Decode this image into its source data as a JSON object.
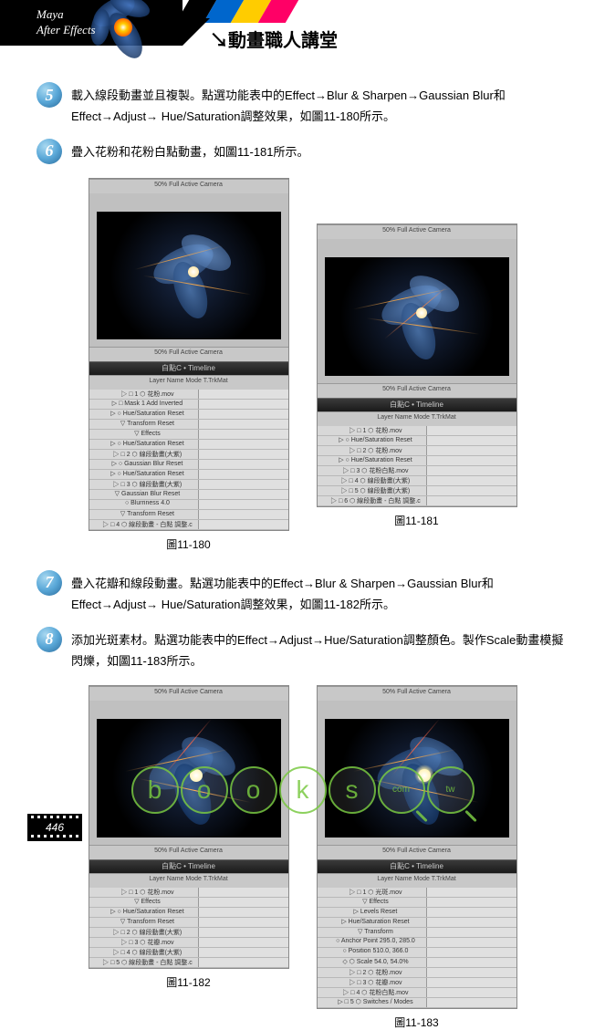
{
  "header": {
    "product1": "Maya",
    "product2": "After Effects",
    "title": "動畫職人講堂",
    "arrow": "↘"
  },
  "steps": [
    {
      "num": "5",
      "text": "載入線段動畫並且複製。點選功能表中的Effect→Blur & Sharpen→Gaussian Blur和Effect→Adjust→ Hue/Saturation調整效果，如圖11-180所示。"
    },
    {
      "num": "6",
      "text": "疊入花粉和花粉白點動畫，如圖11-181所示。"
    },
    {
      "num": "7",
      "text": "疊入花瓣和線段動畫。點選功能表中的Effect→Blur & Sharpen→Gaussian Blur和Effect→Adjust→ Hue/Saturation調整效果，如圖11-182所示。"
    },
    {
      "num": "8",
      "text": "添加光斑素材。點選功能表中的Effect→Adjust→Hue/Saturation調整顏色。製作Scale動畫模擬閃爍，如圖11-183所示。"
    }
  ],
  "figures": {
    "f180": {
      "caption": "圖11-180",
      "timeline_title": "白點C • Timeline"
    },
    "f181": {
      "caption": "圖11-181",
      "timeline_title": "白點C • Timeline"
    },
    "f182": {
      "caption": "圖11-182",
      "timeline_title": "白點C • Timeline"
    },
    "f183": {
      "caption": "圖11-183",
      "timeline_title": "白點C • Timeline"
    }
  },
  "ae_ui": {
    "controls": "50%   Full   Active Camera",
    "timeline_cols": "Layer Name   Mode   T.TrkMat",
    "rows_180": [
      "▷ □ 1 ⬡ 花粉.mov",
      "▷ □ Mask 1   Add   Inverted",
      "▷ ○ Hue/Saturation   Reset",
      "▽ Transform   Reset",
      "▽ Effects",
      "▷ ○ Hue/Saturation   Reset",
      "▷ □ 2 ⬡ 線段動畫(大紫)",
      "▷ ○ Gaussian Blur   Reset",
      "▷ ○ Hue/Saturation   Reset",
      "▷ □ 3 ⬡ 線段動畫(大紫)",
      "▽ Gaussian Blur   Reset",
      "○ Blurriness   4.0",
      "▽ Transform   Reset",
      "▷ □ 4 ⬡ 線段動畫 - 白點 調整.c"
    ],
    "rows_181": [
      "▷ □ 1 ⬡ 花粉.mov",
      "▷ ○ Hue/Saturation   Reset",
      "▷ □ 2 ⬡ 花粉.mov",
      "▷ ○ Hue/Saturation   Reset",
      "▷ □ 3 ⬡ 花粉白點.mov",
      "▷ □ 4 ⬡ 線段動畫(大紫)",
      "▷ □ 5 ⬡ 線段動畫(大紫)",
      "▷ □ 6 ⬡ 線段動畫 - 白點 調整.c"
    ],
    "rows_182": [
      "▷ □ 1 ⬡ 花粉.mov",
      "▽ Effects",
      "▷ ○ Hue/Saturation   Reset",
      "▽ Transform   Reset",
      "▷ □ 2 ⬡ 線段動畫(大紫)",
      "▷ □ 3 ⬡ 花瓣.mov",
      "▷ □ 4 ⬡ 線段動畫(大紫)",
      "▷ □ 5 ⬡ 線段動畫 - 白點 調整.c"
    ],
    "rows_183": [
      "▷ □ 1 ⬡ 光斑.mov",
      "▽ Effects",
      "▷ Levels   Reset",
      "▷ Hue/Saturation   Reset",
      "▽ Transform",
      "○ Anchor Point   295.0, 285.0",
      "○ Position   510.0, 366.0",
      "◇ ⬡ Scale   54.0, 54.0%",
      "▷ □ 2 ⬡ 花粉.mov",
      "▷ □ 3 ⬡ 花瓣.mov",
      "▷ □ 4 ⬡ 花粉白點.mov",
      "▷ □ 5 ⬡ Switches / Modes"
    ]
  },
  "watermark": {
    "letters": [
      "b",
      "o",
      "o",
      "k",
      "s"
    ],
    "suffix1": "com",
    "suffix2": "tw"
  },
  "page": "446"
}
